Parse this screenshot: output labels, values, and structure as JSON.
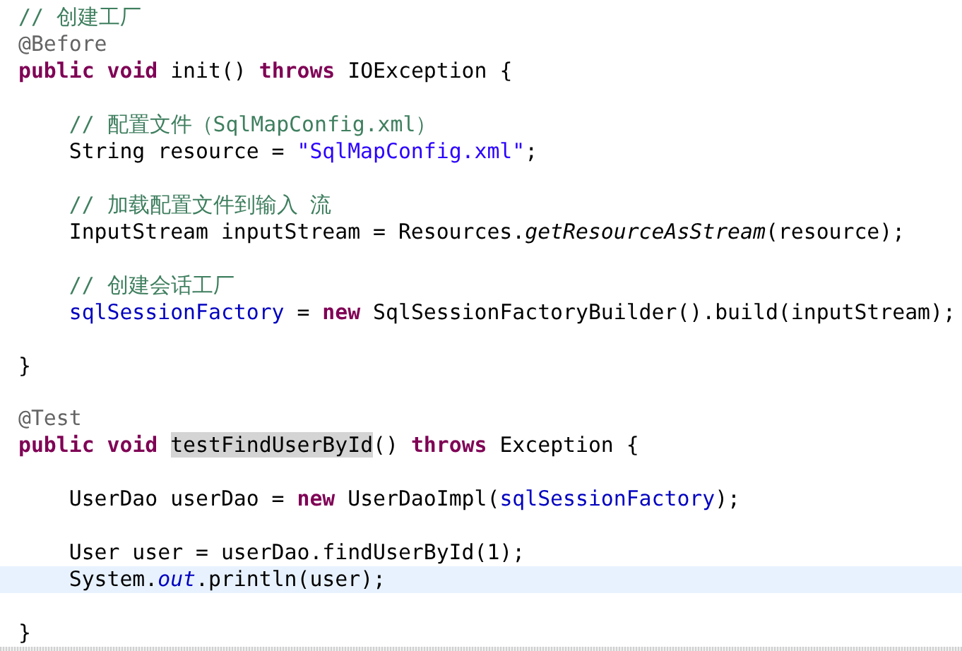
{
  "editor": {
    "lines": [
      {
        "kind": "code",
        "current": false,
        "tokens": [
          {
            "kind": "comment",
            "text": "// 创建工厂"
          }
        ]
      },
      {
        "kind": "code",
        "current": false,
        "tokens": [
          {
            "kind": "annotation",
            "text": "@Before"
          }
        ]
      },
      {
        "kind": "code",
        "current": false,
        "tokens": [
          {
            "kind": "keyword",
            "text": "public"
          },
          {
            "kind": "keyword",
            "text": " void"
          },
          {
            "kind": "plain",
            "text": " init() "
          },
          {
            "kind": "keyword",
            "text": "throws"
          },
          {
            "kind": "plain",
            "text": " IOException {"
          }
        ]
      },
      {
        "kind": "blank",
        "current": false
      },
      {
        "kind": "code",
        "current": false,
        "tokens": [
          {
            "kind": "comment",
            "text": "    // 配置文件（SqlMapConfig.xml）"
          }
        ]
      },
      {
        "kind": "code",
        "current": false,
        "tokens": [
          {
            "kind": "plain",
            "text": "    String resource = "
          },
          {
            "kind": "string",
            "text": "\"SqlMapConfig.xml\""
          },
          {
            "kind": "plain",
            "text": ";"
          }
        ]
      },
      {
        "kind": "blank",
        "current": false
      },
      {
        "kind": "code",
        "current": false,
        "tokens": [
          {
            "kind": "comment",
            "text": "    // 加载配置文件到输入 流"
          }
        ]
      },
      {
        "kind": "code",
        "current": false,
        "tokens": [
          {
            "kind": "plain",
            "text": "    InputStream inputStream = Resources."
          },
          {
            "kind": "static_method",
            "text": "getResourceAsStream"
          },
          {
            "kind": "plain",
            "text": "(resource);"
          }
        ]
      },
      {
        "kind": "blank",
        "current": false
      },
      {
        "kind": "code",
        "current": false,
        "tokens": [
          {
            "kind": "comment",
            "text": "    // 创建会话工厂"
          }
        ]
      },
      {
        "kind": "code",
        "current": false,
        "tokens": [
          {
            "kind": "field",
            "text": "    sqlSessionFactory"
          },
          {
            "kind": "plain",
            "text": " = "
          },
          {
            "kind": "keyword",
            "text": "new"
          },
          {
            "kind": "plain",
            "text": " SqlSessionFactoryBuilder().build(inputStream);"
          }
        ]
      },
      {
        "kind": "blank",
        "current": false
      },
      {
        "kind": "code",
        "current": false,
        "tokens": [
          {
            "kind": "plain",
            "text": "}"
          }
        ]
      },
      {
        "kind": "blank",
        "current": false
      },
      {
        "kind": "code",
        "current": false,
        "tokens": [
          {
            "kind": "annotation",
            "text": "@Test"
          }
        ]
      },
      {
        "kind": "code",
        "current": false,
        "tokens": [
          {
            "kind": "keyword",
            "text": "public"
          },
          {
            "kind": "keyword",
            "text": " void "
          },
          {
            "kind": "occurrence",
            "text": "testFindUserById"
          },
          {
            "kind": "plain",
            "text": "() "
          },
          {
            "kind": "keyword",
            "text": "throws"
          },
          {
            "kind": "plain",
            "text": " Exception {"
          }
        ]
      },
      {
        "kind": "blank",
        "current": false
      },
      {
        "kind": "code",
        "current": false,
        "tokens": [
          {
            "kind": "plain",
            "text": "    UserDao userDao = "
          },
          {
            "kind": "keyword",
            "text": "new"
          },
          {
            "kind": "plain",
            "text": " UserDaoImpl("
          },
          {
            "kind": "field",
            "text": "sqlSessionFactory"
          },
          {
            "kind": "plain",
            "text": ");"
          }
        ]
      },
      {
        "kind": "blank",
        "current": false
      },
      {
        "kind": "code",
        "current": false,
        "tokens": [
          {
            "kind": "plain",
            "text": "    User user = userDao.findUserById(1);"
          }
        ]
      },
      {
        "kind": "code",
        "current": true,
        "tokens": [
          {
            "kind": "plain",
            "text": "    System."
          },
          {
            "kind": "static_field",
            "text": "out"
          },
          {
            "kind": "plain",
            "text": ".println(user);"
          }
        ]
      },
      {
        "kind": "blank",
        "current": false
      },
      {
        "kind": "code",
        "current": false,
        "tokens": [
          {
            "kind": "plain",
            "text": "}"
          }
        ]
      }
    ]
  }
}
